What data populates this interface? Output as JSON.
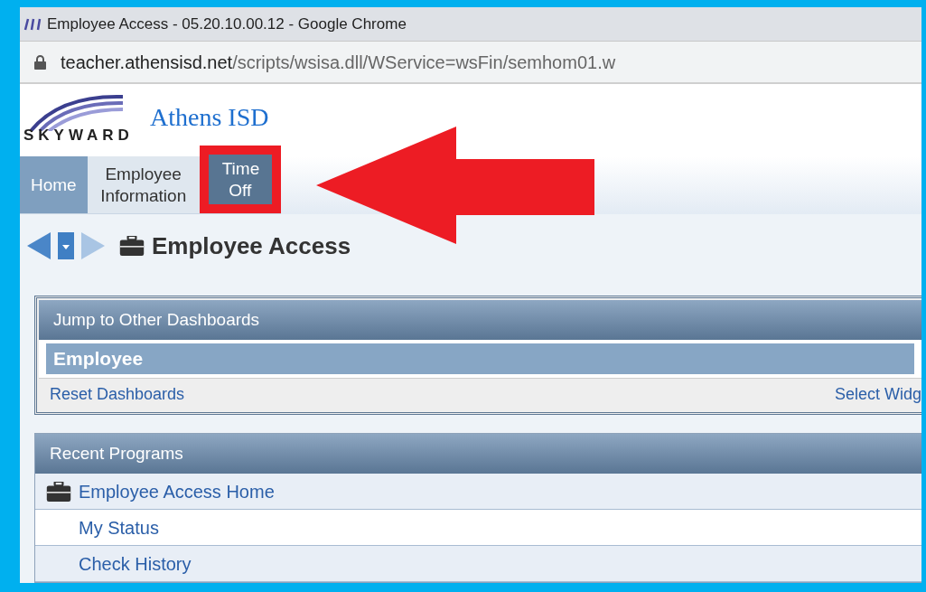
{
  "window": {
    "title": "Employee Access - 05.20.10.00.12 - Google Chrome"
  },
  "address_bar": {
    "host": "teacher.athensisd.net",
    "path": "/scripts/wsisa.dll/WService=wsFin/semhom01.w"
  },
  "header": {
    "logo_text": "SKYWARD",
    "district": "Athens ISD"
  },
  "tabs": [
    {
      "label": "Home",
      "selected": true,
      "highlighted": false
    },
    {
      "label": "Employee Information",
      "selected": false,
      "highlighted": false
    },
    {
      "label": "Time Off",
      "selected": false,
      "highlighted": true
    }
  ],
  "page_title": "Employee Access",
  "dashboards": {
    "title": "Jump to Other Dashboards",
    "current": "Employee",
    "links": [
      "Reset Dashboards",
      "Select Widg"
    ]
  },
  "recent_programs": {
    "title": "Recent Programs",
    "items": [
      {
        "label": "Employee Access Home",
        "kind": "program"
      },
      {
        "label": "My Status",
        "kind": "sub"
      },
      {
        "label": "Check History",
        "kind": "sub"
      }
    ]
  }
}
